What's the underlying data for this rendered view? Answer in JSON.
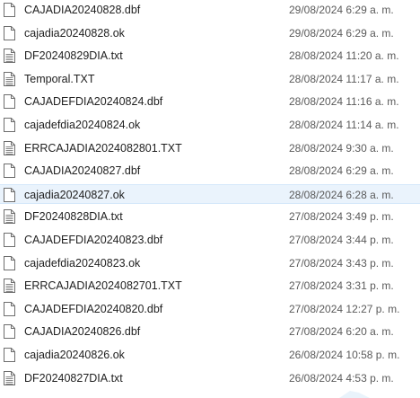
{
  "selected_index": 8,
  "files": [
    {
      "name": "CAJADIA20240828.dbf",
      "modified": "29/08/2024 6:29 a. m.",
      "icon": "blank-file-icon"
    },
    {
      "name": "cajadia20240828.ok",
      "modified": "29/08/2024 6:29 a. m.",
      "icon": "blank-file-icon"
    },
    {
      "name": "DF20240829DIA.txt",
      "modified": "28/08/2024 11:20 a. m.",
      "icon": "text-file-icon"
    },
    {
      "name": "Temporal.TXT",
      "modified": "28/08/2024 11:17 a. m.",
      "icon": "text-file-icon"
    },
    {
      "name": "CAJADEFDIA20240824.dbf",
      "modified": "28/08/2024 11:16 a. m.",
      "icon": "blank-file-icon"
    },
    {
      "name": "cajadefdia20240824.ok",
      "modified": "28/08/2024 11:14 a. m.",
      "icon": "blank-file-icon"
    },
    {
      "name": "ERRCAJADIA2024082801.TXT",
      "modified": "28/08/2024 9:30 a. m.",
      "icon": "text-file-icon"
    },
    {
      "name": "CAJADIA20240827.dbf",
      "modified": "28/08/2024 6:29 a. m.",
      "icon": "blank-file-icon"
    },
    {
      "name": "cajadia20240827.ok",
      "modified": "28/08/2024 6:28 a. m.",
      "icon": "blank-file-icon"
    },
    {
      "name": "DF20240828DIA.txt",
      "modified": "27/08/2024 3:49 p. m.",
      "icon": "text-file-icon"
    },
    {
      "name": "CAJADEFDIA20240823.dbf",
      "modified": "27/08/2024 3:44 p. m.",
      "icon": "blank-file-icon"
    },
    {
      "name": "cajadefdia20240823.ok",
      "modified": "27/08/2024 3:43 p. m.",
      "icon": "blank-file-icon"
    },
    {
      "name": "ERRCAJADIA2024082701.TXT",
      "modified": "27/08/2024 3:31 p. m.",
      "icon": "text-file-icon"
    },
    {
      "name": "CAJADEFDIA20240820.dbf",
      "modified": "27/08/2024 12:27 p. m.",
      "icon": "blank-file-icon"
    },
    {
      "name": "CAJADIA20240826.dbf",
      "modified": "27/08/2024 6:20 a. m.",
      "icon": "blank-file-icon"
    },
    {
      "name": "cajadia20240826.ok",
      "modified": "26/08/2024 10:58 p. m.",
      "icon": "blank-file-icon"
    },
    {
      "name": "DF20240827DIA.txt",
      "modified": "26/08/2024 4:53 p. m.",
      "icon": "text-file-icon"
    }
  ]
}
